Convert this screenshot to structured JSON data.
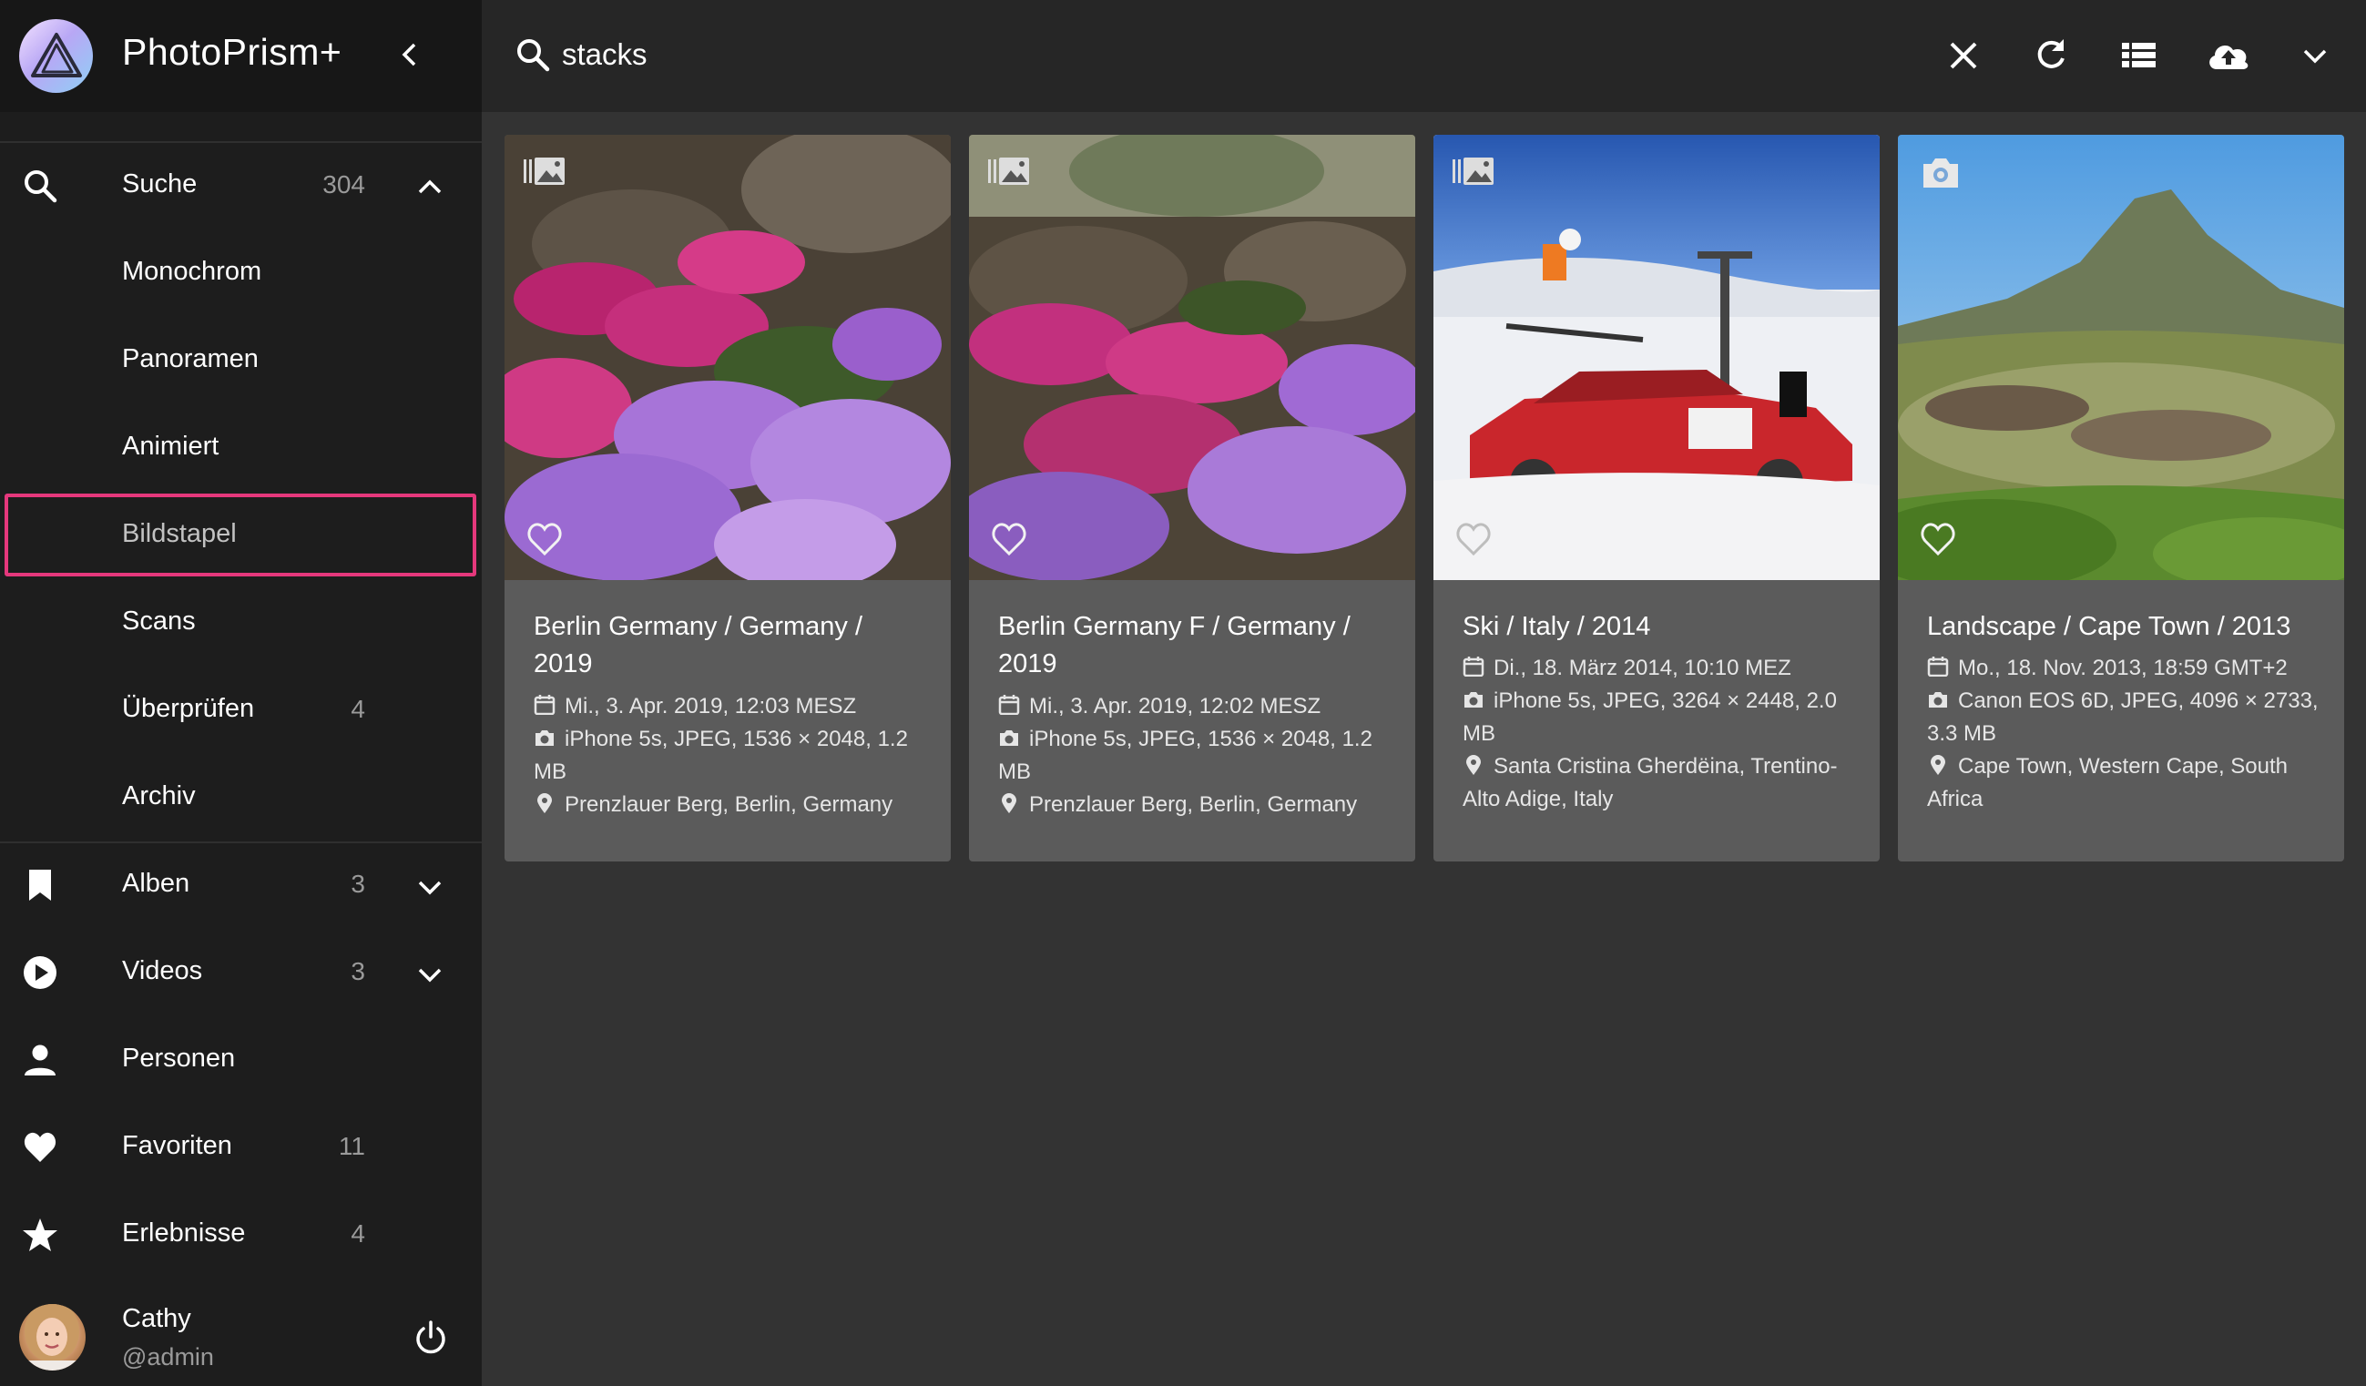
{
  "app": {
    "title": "PhotoPrism+"
  },
  "sidebar": {
    "items": [
      {
        "label": "Suche",
        "count": "304",
        "icon": "search-icon"
      },
      {
        "label": "Monochrom"
      },
      {
        "label": "Panoramen"
      },
      {
        "label": "Animiert"
      },
      {
        "label": "Bildstapel",
        "selected": true
      },
      {
        "label": "Scans"
      },
      {
        "label": "Überprüfen",
        "count": "4"
      },
      {
        "label": "Archiv"
      },
      {
        "label": "Alben",
        "count": "3",
        "icon": "bookmark-icon"
      },
      {
        "label": "Videos",
        "count": "3",
        "icon": "play-circle-icon"
      },
      {
        "label": "Personen",
        "icon": "person-icon"
      },
      {
        "label": "Favoriten",
        "count": "11",
        "icon": "heart-icon"
      },
      {
        "label": "Erlebnisse",
        "count": "4",
        "icon": "star-icon"
      }
    ],
    "user": {
      "name": "Cathy",
      "handle": "@admin"
    }
  },
  "search": {
    "value": "stacks",
    "placeholder": ""
  },
  "colors": {
    "accent": "#e5387c",
    "card_bg": "#5b5b5b",
    "sidebar_bg": "#1d1d1d",
    "page_bg": "#333333"
  },
  "cards": [
    {
      "title": "Berlin Germany / Germany / 2019",
      "date": "Mi., 3. Apr. 2019, 12:03 MESZ",
      "camera": "iPhone 5s, JPEG, 1536 × 2048, 1.2 MB",
      "location": "Prenzlauer Berg, Berlin, Germany",
      "type_icon": "stack-icon"
    },
    {
      "title": "Berlin Germany F / Germany / 2019",
      "date": "Mi., 3. Apr. 2019, 12:02 MESZ",
      "camera": "iPhone 5s, JPEG, 1536 × 2048, 1.2 MB",
      "location": "Prenzlauer Berg, Berlin, Germany",
      "type_icon": "stack-icon"
    },
    {
      "title": "Ski / Italy / 2014",
      "date": "Di., 18. März 2014, 10:10 MEZ",
      "camera": "iPhone 5s, JPEG, 3264 × 2448, 2.0 MB",
      "location": "Santa Cristina Gherdëina, Trentino-Alto Adige, Italy",
      "type_icon": "stack-icon"
    },
    {
      "title": "Landscape / Cape Town / 2013",
      "date": "Mo., 18. Nov. 2013, 18:59 GMT+2",
      "camera": "Canon EOS 6D, JPEG, 4096 × 2733, 3.3 MB",
      "location": "Cape Town, Western Cape, South Africa",
      "type_icon": "camera-icon"
    }
  ]
}
